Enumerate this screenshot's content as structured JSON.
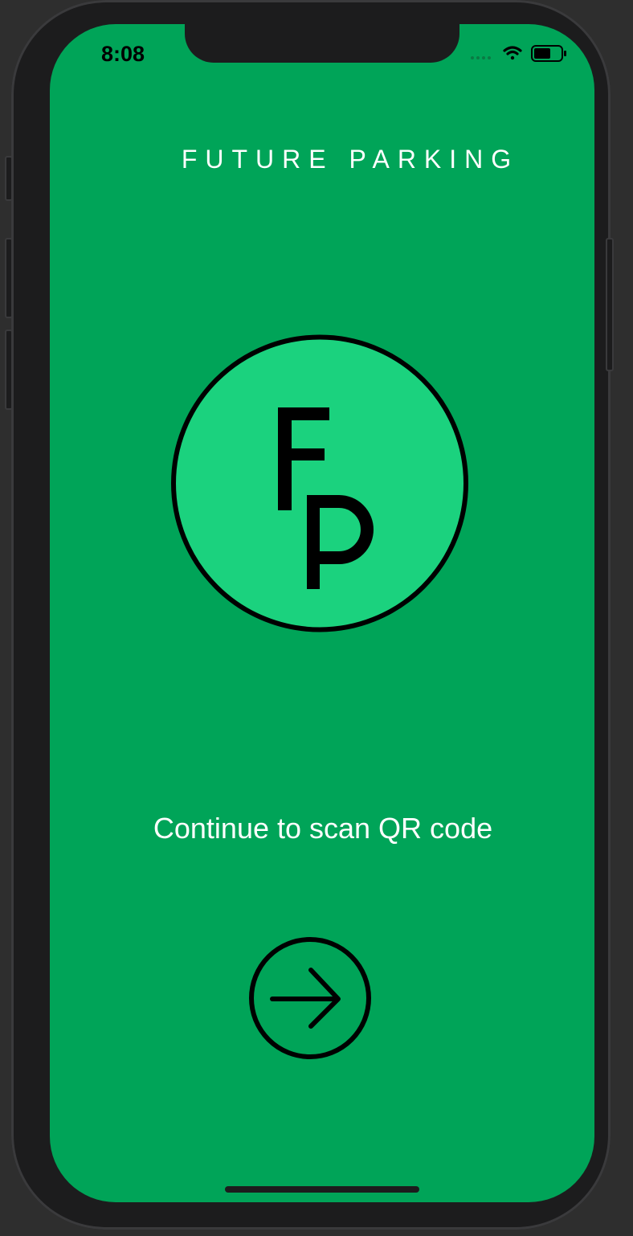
{
  "status_bar": {
    "time": "8:08",
    "icons": [
      "signal-dots-icon",
      "wifi-icon",
      "battery-icon"
    ]
  },
  "header": {
    "title": "FUTURE PARKING"
  },
  "logo": {
    "letters": [
      "F",
      "P"
    ],
    "fill_color": "#1bd27e",
    "stroke_color": "#000000"
  },
  "main": {
    "prompt": "Continue to scan QR code",
    "next_button": {
      "icon": "arrow-right-icon"
    }
  },
  "colors": {
    "background": "#00a458",
    "text": "#ffffff",
    "frame": "#1c1c1d"
  }
}
